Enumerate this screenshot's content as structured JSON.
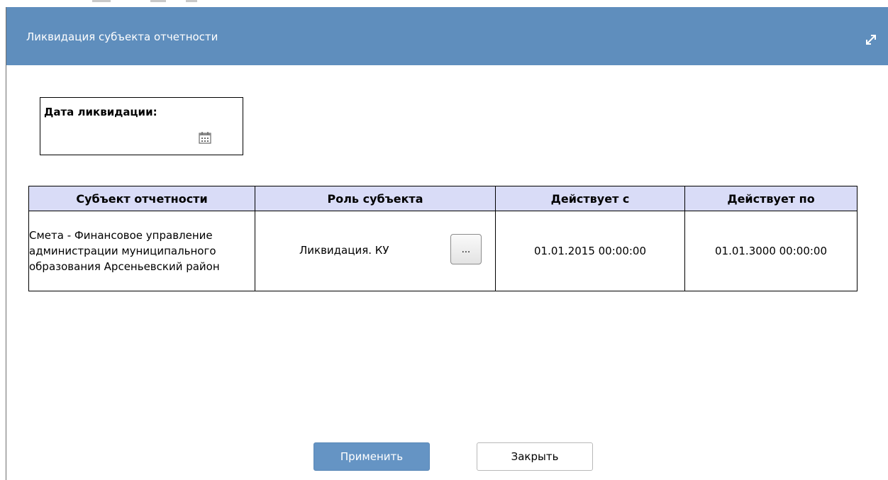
{
  "dialog": {
    "title": "Ликвидация субъекта отчетности"
  },
  "liquidation_date": {
    "label": "Дата ликвидации:",
    "value": ""
  },
  "table": {
    "headers": [
      "Субъект отчетности",
      "Роль субъекта",
      "Действует с",
      "Действует по"
    ],
    "rows": [
      {
        "subject": "Смета - Финансовое управление администрации муниципального образования Арсеньевский район",
        "role": "Ликвидация. КУ",
        "role_button": "...",
        "valid_from": "01.01.2015 00:00:00",
        "valid_to": "01.01.3000 00:00:00"
      }
    ]
  },
  "buttons": {
    "apply": "Применить",
    "close": "Закрыть"
  },
  "colors": {
    "titlebar": "#5f8ebd",
    "table_header": "#d9dcf7",
    "apply_button": "#6594c4"
  },
  "icons": {
    "expand": "expand-icon",
    "calendar": "calendar-icon"
  }
}
